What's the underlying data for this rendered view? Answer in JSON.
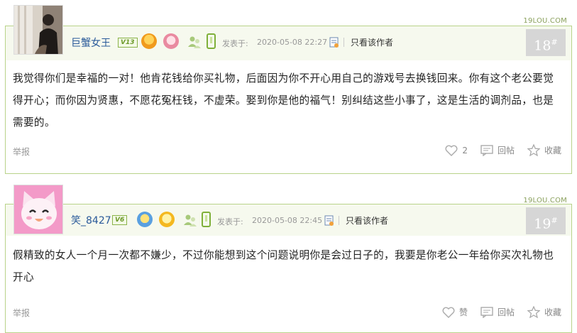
{
  "posts": [
    {
      "username": "巨蟹女王",
      "level": "V13",
      "site": "19LOU.COM",
      "posted_label": "发表于:",
      "posted_time": "2020-05-08 22:27",
      "author_only": "只看该作者",
      "floor": "18",
      "floor_mark": "#",
      "content": "我觉得你们是幸福的一对！他肯花钱给你买礼物，后面因为你不开心用自己的游戏号去换钱回来。你有这个老公要觉得开心；而你因为贤惠，不愿花冤枉钱，不虚荣。娶到你是他的福气！别纠结这些小事了，这是生活的调剂品，也是需要的。",
      "report": "举报",
      "like_label": "2",
      "reply_label": "回帖",
      "fav_label": "收藏"
    },
    {
      "username": "笑_8427",
      "level": "V6",
      "site": "19LOU.COM",
      "posted_label": "发表于:",
      "posted_time": "2020-05-08 22:45",
      "author_only": "只看该作者",
      "floor": "19",
      "floor_mark": "#",
      "content": "假精致的女人一个月一次都不嫌少，不过你能想到这个问题说明你是会过日子的，我要是你老公一年给你买次礼物也开心",
      "report": "举报",
      "like_label": "赞",
      "reply_label": "回帖",
      "fav_label": "收藏"
    }
  ],
  "colors": {
    "border": "#b9d38a",
    "username": "#2a5a9a",
    "floor_bg": "#d6d6d6"
  },
  "icons": [
    "avatar",
    "level-badge",
    "medal-icon",
    "people-icon",
    "phone-icon",
    "document-icon",
    "heart-icon",
    "reply-icon",
    "star-icon"
  ]
}
